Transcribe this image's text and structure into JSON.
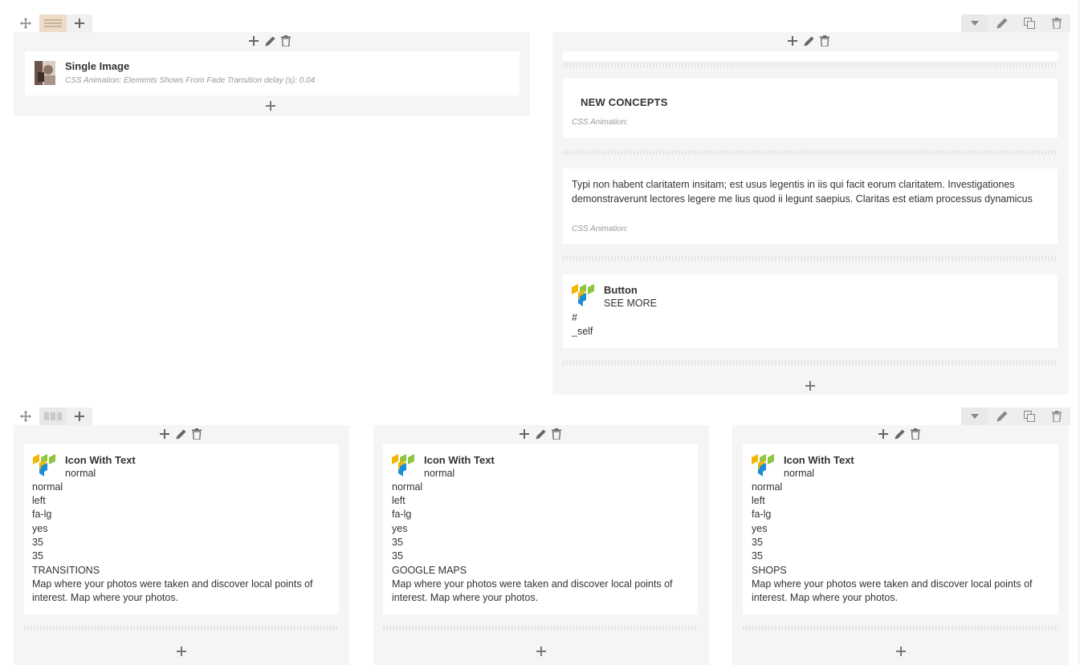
{
  "icons": {
    "move": "move-icon",
    "layout": "layout-icon",
    "add": "plus-icon",
    "edit": "pencil-icon",
    "delete": "trash-icon",
    "toggle": "chevron-down-icon",
    "clone": "clone-icon",
    "vc_logo": "visual-composer-logo-icon",
    "image_thumb": "image-thumbnail-icon"
  },
  "colors": {
    "column_bg": "#f5f5f5",
    "element_bg": "#ffffff",
    "text": "#333333",
    "meta": "#999999",
    "logo_yellow": "#f2b705",
    "logo_green": "#8dc63f",
    "logo_blue": "#1c8ed1"
  },
  "row1": {
    "left_column": {
      "single_image": {
        "title": "Single Image",
        "meta": "CSS Animation: Elements Shows From Fade  Transition delay (s): 0.04"
      }
    },
    "right_column": {
      "heading": {
        "text": "NEW CONCEPTS",
        "meta": "CSS Animation:"
      },
      "text_block": {
        "text": "Typi non habent claritatem insitam; est usus legentis in iis qui facit eorum claritatem. Investigationes demonstraverunt lectores legere me lius quod ii legunt saepius. Claritas est etiam processus dynamicus",
        "meta": "CSS Animation:"
      },
      "button": {
        "title": "Button",
        "label": "SEE MORE",
        "link": "#",
        "target": "_self"
      }
    }
  },
  "row2": {
    "columns": [
      {
        "title": "Icon With Text",
        "lines": [
          "normal",
          "normal",
          "left",
          "fa-lg",
          "yes",
          "35",
          "35",
          "TRANSITIONS"
        ],
        "desc": "Map where your photos were taken and discover local points of interest. Map where your photos."
      },
      {
        "title": "Icon With Text",
        "lines": [
          "normal",
          "normal",
          "left",
          "fa-lg",
          "yes",
          "35",
          "35",
          "GOOGLE MAPS"
        ],
        "desc": "Map where your photos were taken and discover local points of interest. Map where your photos."
      },
      {
        "title": "Icon With Text",
        "lines": [
          "normal",
          "normal",
          "left",
          "fa-lg",
          "yes",
          "35",
          "35",
          "SHOPS"
        ],
        "desc": "Map where your photos were taken and discover local points of interest. Map where your photos."
      }
    ]
  }
}
